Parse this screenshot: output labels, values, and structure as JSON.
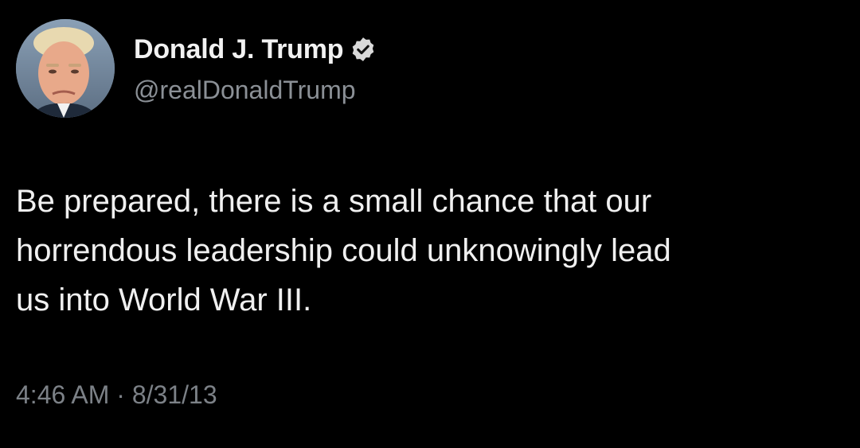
{
  "author": {
    "display_name": "Donald J. Trump",
    "handle": "@realDonaldTrump",
    "verified_icon": "verified-badge-icon",
    "avatar_icon": "profile-photo"
  },
  "tweet": {
    "text": "Be prepared, there is a small chance that our\nhorrendous leadership could unknowingly lead\nus into World War III.",
    "time": "4:46 AM",
    "separator": "·",
    "date": "8/31/13"
  },
  "colors": {
    "background": "#000000",
    "text": "#e7e9ea",
    "muted": "#8b9096",
    "verified": "#d9d9d9"
  }
}
